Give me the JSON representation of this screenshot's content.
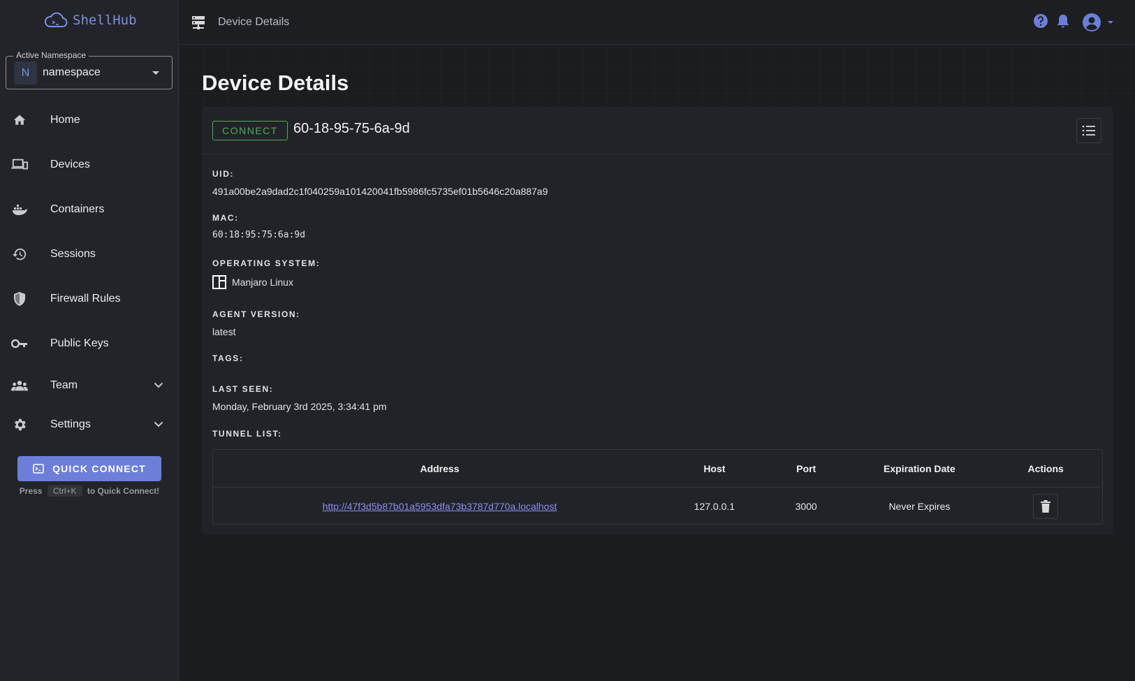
{
  "app": {
    "name": "ShellHub"
  },
  "namespace": {
    "legend": "Active Namespace",
    "avatar": "N",
    "name": "namespace"
  },
  "sidebar": {
    "items": [
      {
        "label": "Home",
        "icon": "home-icon"
      },
      {
        "label": "Devices",
        "icon": "devices-icon"
      },
      {
        "label": "Containers",
        "icon": "docker-icon"
      },
      {
        "label": "Sessions",
        "icon": "history-icon"
      },
      {
        "label": "Firewall Rules",
        "icon": "shield-icon"
      },
      {
        "label": "Public Keys",
        "icon": "key-icon"
      },
      {
        "label": "Team",
        "icon": "team-icon"
      },
      {
        "label": "Settings",
        "icon": "gear-icon"
      }
    ],
    "quick_connect": {
      "label": "QUICK CONNECT",
      "hint_prefix": "Press",
      "hint_key": "Ctrl+K",
      "hint_suffix": "to Quick Connect!"
    }
  },
  "topbar": {
    "title": "Device Details"
  },
  "page": {
    "title": "Device Details"
  },
  "device": {
    "connect_label": "CONNECT",
    "name": "60-18-95-75-6a-9d",
    "uid_label": "UID:",
    "uid": "491a00be2a9dad2c1f040259a101420041fb5986fc5735ef01b5646c20a887a9",
    "mac_label": "MAC:",
    "mac": "60:18:95:75:6a:9d",
    "os_label": "OPERATING SYSTEM:",
    "os": "Manjaro Linux",
    "agent_label": "AGENT VERSION:",
    "agent": "latest",
    "tags_label": "TAGS:",
    "last_seen_label": "LAST SEEN:",
    "last_seen": "Monday, February 3rd 2025, 3:34:41 pm",
    "tunnel_label": "TUNNEL LIST:"
  },
  "tunnels": {
    "headers": {
      "address": "Address",
      "host": "Host",
      "port": "Port",
      "expiration": "Expiration Date",
      "actions": "Actions"
    },
    "rows": [
      {
        "address": "http://47f3d5b87b01a5953dfa73b3787d770a.localhost",
        "host": "127.0.0.1",
        "port": "3000",
        "expiration": "Never Expires"
      }
    ]
  },
  "colors": {
    "accent": "#6c7fd8",
    "connect": "#4caf50",
    "link": "#8c8ff0",
    "background": "#1b1c1f",
    "sidebar": "#22242a"
  }
}
